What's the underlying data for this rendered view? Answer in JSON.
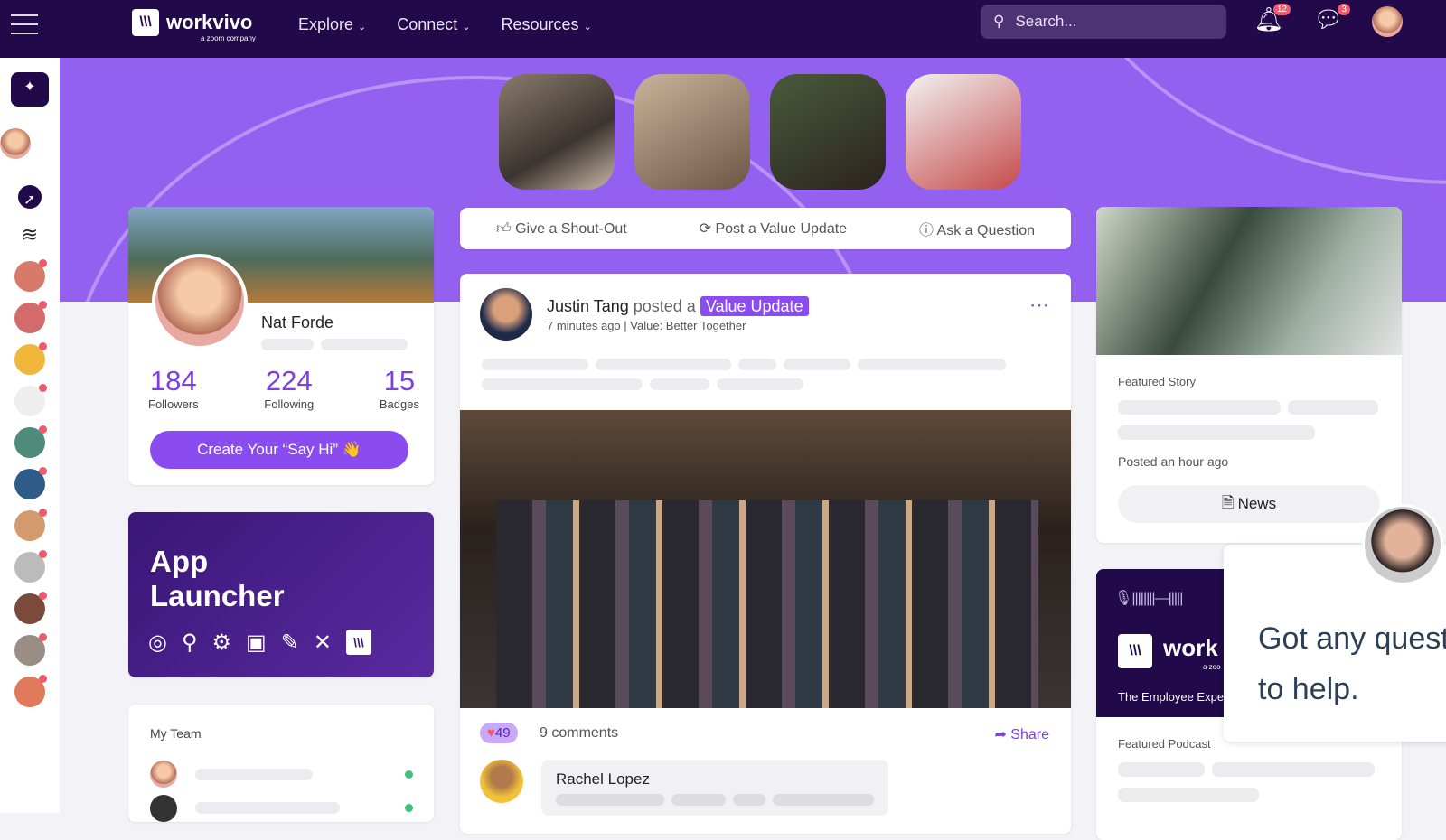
{
  "header": {
    "brand": "workvivo",
    "brand_sub": "a zoom company",
    "nav": [
      {
        "label": "Explore"
      },
      {
        "label": "Connect"
      },
      {
        "label": "Resources"
      }
    ],
    "search_placeholder": "Search...",
    "notifications": "12",
    "messages": "3"
  },
  "sidebar": {
    "items": [
      "ai-sparkle",
      "profile",
      "compass",
      "layers",
      "space",
      "space",
      "headphones",
      "space",
      "globe",
      "lock",
      "space",
      "camera",
      "space",
      "space",
      "space"
    ]
  },
  "profile": {
    "name": "Nat Forde",
    "stats": [
      {
        "value": "184",
        "label": "Followers"
      },
      {
        "value": "224",
        "label": "Following"
      },
      {
        "value": "15",
        "label": "Badges"
      }
    ],
    "cta": "Create Your “Say Hi” 👋"
  },
  "app_launcher": {
    "title_1": "App",
    "title_2": "Launcher"
  },
  "my_team": {
    "title": "My Team"
  },
  "actions": [
    {
      "label": "Give a Shout-Out",
      "icon": "thumbs-up"
    },
    {
      "label": "Post a Value Update",
      "icon": "value-update"
    },
    {
      "label": "Ask a Question",
      "icon": "question"
    }
  ],
  "post": {
    "author": "Justin Tang",
    "verb": "posted a",
    "tag": "Value Update",
    "time": "7 minutes ago",
    "value": "| Value: Better Together",
    "likes": "49",
    "comments": "9 comments",
    "share": "Share",
    "commenter": "Rachel Lopez"
  },
  "featured_story": {
    "label": "Featured Story",
    "time": "Posted an hour ago",
    "button": "News"
  },
  "podcast": {
    "brand": "work",
    "brand_sub": "a zoo",
    "tagline": "The Employee Expe",
    "label": "Featured Podcast"
  },
  "chat": {
    "line1": "Got any quest",
    "line2": "to help."
  },
  "colors": {
    "header": "#22094a",
    "accent": "#8a4cf0",
    "hero": "#9460f0",
    "badge": "#f05a6e"
  }
}
